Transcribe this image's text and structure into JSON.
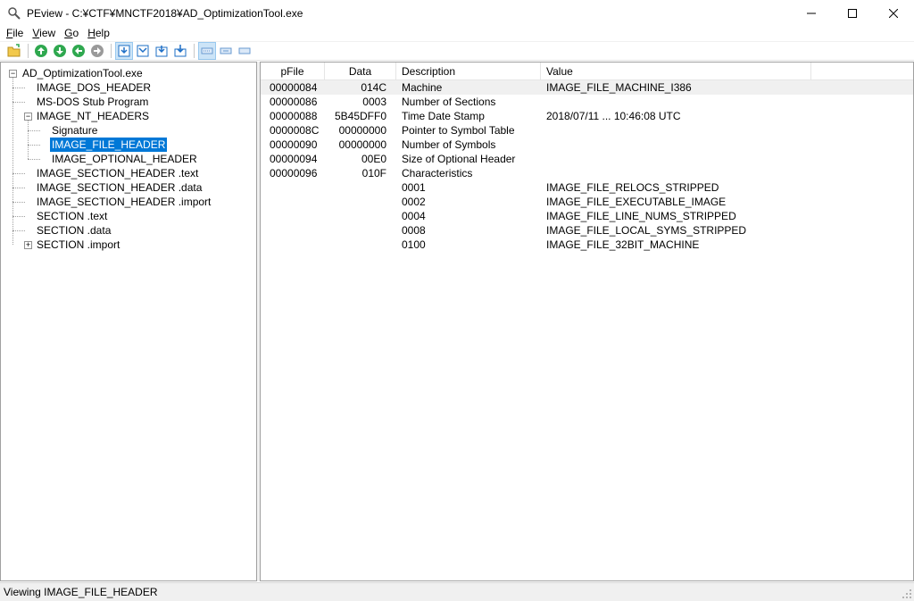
{
  "window": {
    "title": "PEview - C:¥CTF¥MNCTF2018¥AD_OptimizationTool.exe",
    "icon": "magnifier-icon",
    "controls": [
      "minimize-icon",
      "maximize-icon",
      "close-icon"
    ]
  },
  "menu": {
    "items": [
      {
        "label": "File",
        "accel": "F",
        "rest": "ile"
      },
      {
        "label": "View",
        "accel": "V",
        "rest": "iew"
      },
      {
        "label": "Go",
        "accel": "G",
        "rest": "o"
      },
      {
        "label": "Help",
        "accel": "H",
        "rest": "elp"
      }
    ]
  },
  "toolbar": {
    "buttons": [
      "open-folder-icon",
      "back-icon",
      "forward-icon",
      "up-icon",
      "down-icon",
      "view-byte-icon",
      "view-word-icon",
      "view-dword-icon",
      "view-qword-icon",
      "view-sections-icon",
      "view-offsets-icon",
      "view-rva-icon"
    ],
    "active": [
      "view-byte-icon",
      "view-sections-icon"
    ]
  },
  "tree": {
    "root": "AD_OptimizationTool.exe",
    "nodes": [
      "IMAGE_DOS_HEADER",
      "MS-DOS Stub Program",
      "IMAGE_NT_HEADERS",
      "Signature",
      "IMAGE_FILE_HEADER",
      "IMAGE_OPTIONAL_HEADER",
      "IMAGE_SECTION_HEADER .text",
      "IMAGE_SECTION_HEADER .data",
      "IMAGE_SECTION_HEADER .import",
      "SECTION .text",
      "SECTION .data",
      "SECTION .import"
    ],
    "selected": "IMAGE_FILE_HEADER"
  },
  "list": {
    "columns": [
      "pFile",
      "Data",
      "Description",
      "Value"
    ],
    "rows": [
      {
        "pfile": "00000084",
        "data": "014C",
        "desc": "Machine",
        "value": "IMAGE_FILE_MACHINE_I386"
      },
      {
        "pfile": "00000086",
        "data": "0003",
        "desc": "Number of Sections",
        "value": ""
      },
      {
        "pfile": "00000088",
        "data": "5B45DFF0",
        "desc": "Time Date Stamp",
        "value": "2018/07/11 ... 10:46:08 UTC"
      },
      {
        "pfile": "0000008C",
        "data": "00000000",
        "desc": "Pointer to Symbol Table",
        "value": ""
      },
      {
        "pfile": "00000090",
        "data": "00000000",
        "desc": "Number of Symbols",
        "value": ""
      },
      {
        "pfile": "00000094",
        "data": "00E0",
        "desc": "Size of Optional Header",
        "value": ""
      },
      {
        "pfile": "00000096",
        "data": "010F",
        "desc": "Characteristics",
        "value": ""
      },
      {
        "pfile": "",
        "data": "",
        "desc": "0001",
        "value": "IMAGE_FILE_RELOCS_STRIPPED"
      },
      {
        "pfile": "",
        "data": "",
        "desc": "0002",
        "value": "IMAGE_FILE_EXECUTABLE_IMAGE"
      },
      {
        "pfile": "",
        "data": "",
        "desc": "0004",
        "value": "IMAGE_FILE_LINE_NUMS_STRIPPED"
      },
      {
        "pfile": "",
        "data": "",
        "desc": "0008",
        "value": "IMAGE_FILE_LOCAL_SYMS_STRIPPED"
      },
      {
        "pfile": "",
        "data": "",
        "desc": "0100",
        "value": "IMAGE_FILE_32BIT_MACHINE"
      }
    ]
  },
  "status": {
    "text": "Viewing IMAGE_FILE_HEADER"
  },
  "colors": {
    "selection": "#0078d7",
    "accent_green": "#2fa84f",
    "accent_blue": "#1e6fc6"
  }
}
